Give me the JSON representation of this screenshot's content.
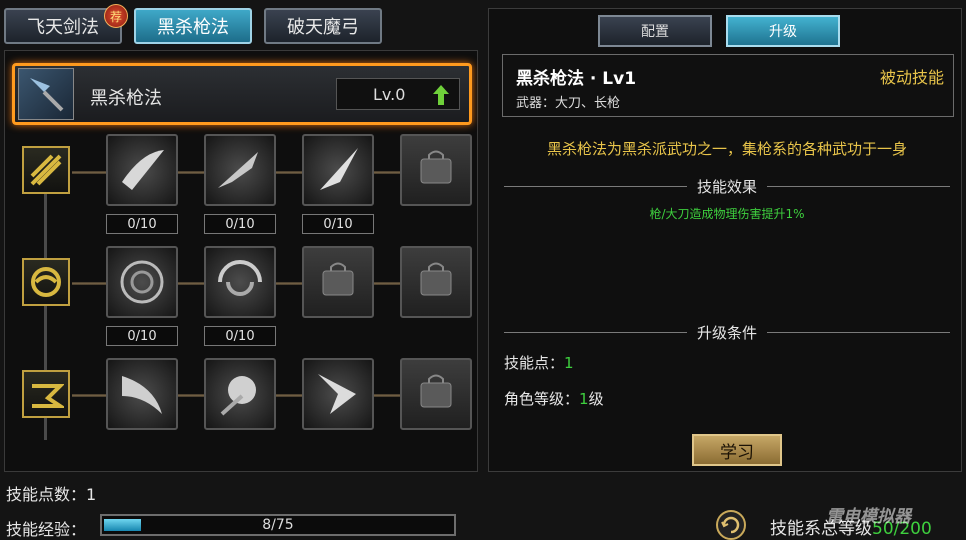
{
  "weapon_tabs": [
    {
      "label": "飞天剑法",
      "badge": "荐"
    },
    {
      "label": "黑杀枪法"
    },
    {
      "label": "破天魔弓"
    }
  ],
  "selected_skill": {
    "name": "黑杀枪法",
    "level": "Lv.0"
  },
  "skill_counts": {
    "row1": [
      "0/10",
      "0/10",
      "0/10"
    ],
    "row2": [
      "0/10",
      "0/10"
    ]
  },
  "right_tabs": [
    "配置",
    "升级"
  ],
  "detail": {
    "title": "黑杀枪法 · Lv1",
    "type": "被动技能",
    "weapon": "武器：大刀、长枪",
    "description": "黑杀枪法为黑杀派武功之一，集枪系的各种武功于一身",
    "effect_header": "技能效果",
    "effect_text": "枪/大刀造成物理伤害提升1%",
    "cond_header": "升级条件",
    "cond_points_label": "技能点：",
    "cond_points_value": "1",
    "cond_level_label": "角色等级：",
    "cond_level_value": "1",
    "cond_level_unit": "级",
    "learn_label": "学习"
  },
  "footer": {
    "points_label": "技能点数：",
    "points_value": "1",
    "exp_label": "技能经验：",
    "exp_text": "8/75",
    "exp_fraction": 0.107,
    "total_level_label": "技能系总等级",
    "total_level_value": "50/200"
  },
  "watermark": "雷电模拟器",
  "colors": {
    "accent_orange": "#ff9a1e",
    "gold_text": "#e8c44a",
    "green_text": "#3ecf3e",
    "tab_active": "#2e8db0"
  }
}
